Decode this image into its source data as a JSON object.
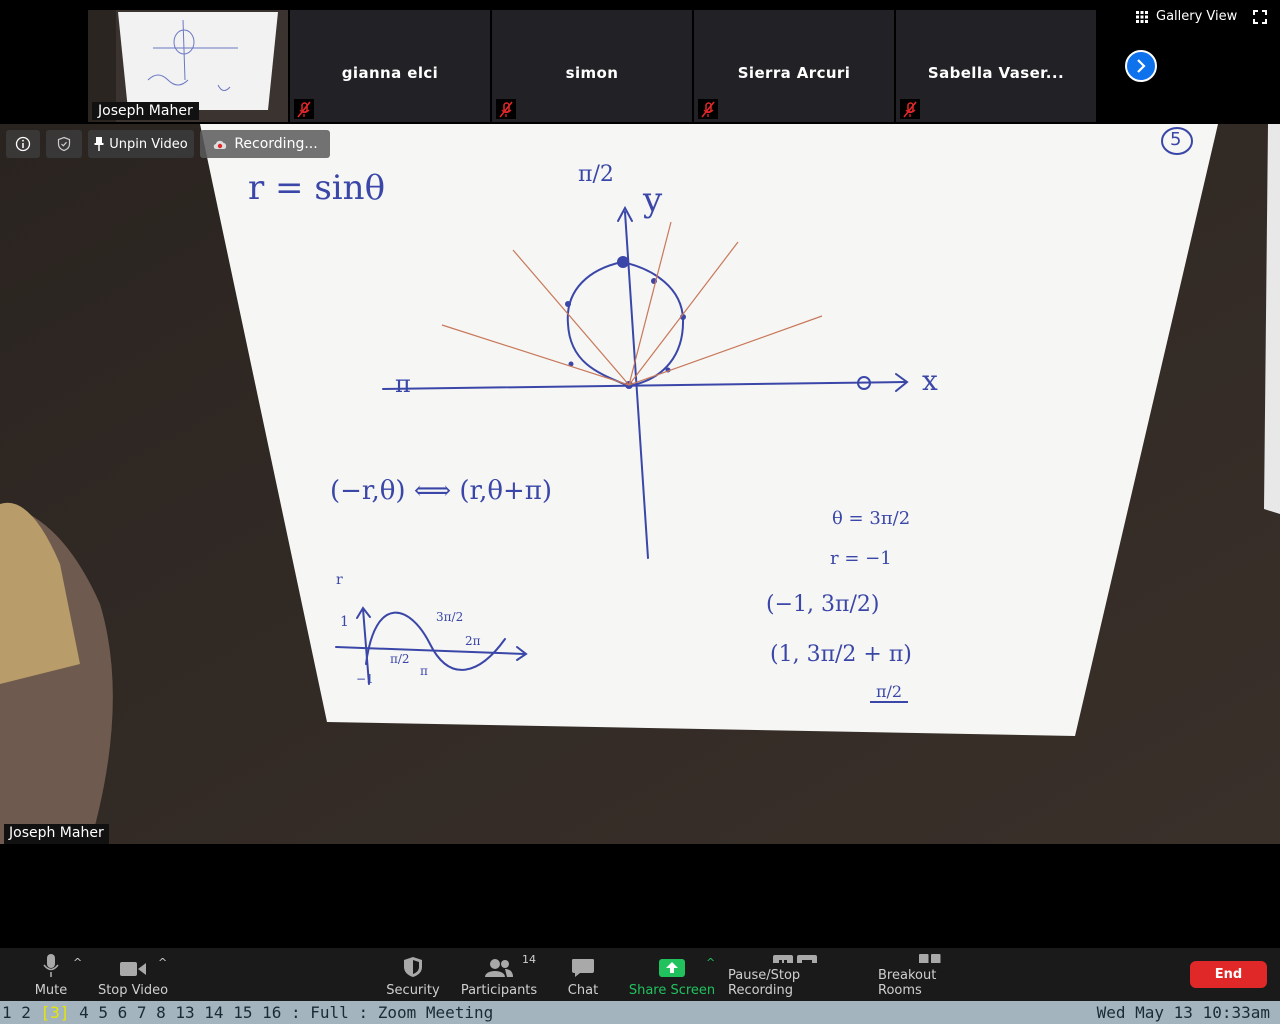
{
  "window": {
    "title": "Zoom Meeting"
  },
  "gallery": {
    "view_label": "Gallery View",
    "self": {
      "name": "Joseph Maher"
    },
    "participants": [
      {
        "name": "gianna elci"
      },
      {
        "name": "simon"
      },
      {
        "name": "Sierra Arcuri"
      },
      {
        "name": "Sabella Vaser..."
      }
    ]
  },
  "video": {
    "controls": {
      "unpin_label": "Unpin Video",
      "recording_label": "Recording..."
    },
    "speaker_name": "Joseph Maher",
    "whiteboard": {
      "equation": "r = sinθ",
      "page_number": "5",
      "axis_y": "y",
      "axis_x": "x",
      "label_top": "π/2",
      "label_left": "π",
      "label_right": "0",
      "identity": "(−r,θ) ⟺ (r,θ+π)",
      "theta_line": "θ = 3π/2",
      "r_line": "r = −1",
      "point_a": "(−1, 3π/2)",
      "point_b": "(1, 3π/2 + π)",
      "point_b_result": "π/2",
      "sketch_labels": {
        "r": "r",
        "one": "1",
        "neg_one": "−1",
        "pi_half": "π/2",
        "pi": "π",
        "three_pi_half": "3π/2",
        "two_pi": "2π"
      }
    }
  },
  "toolbar": {
    "mute": "Mute",
    "stop_video": "Stop Video",
    "security": "Security",
    "participants": "Participants",
    "participants_count": "14",
    "chat": "Chat",
    "share_screen": "Share Screen",
    "pause_stop_recording": "Pause/Stop Recording",
    "breakout_rooms": "Breakout Rooms",
    "end": "End",
    "share_color": "#21c25e",
    "end_color": "#e02828"
  },
  "statusbar": {
    "workspaces": [
      "1",
      "2",
      "[3]",
      "4",
      "5",
      "6",
      "7",
      "8",
      "13",
      "14",
      "15",
      "16",
      ":",
      "Full",
      ":"
    ],
    "current_index": 2,
    "app": "Zoom Meeting",
    "datetime": "Wed May 13 10:33am"
  }
}
